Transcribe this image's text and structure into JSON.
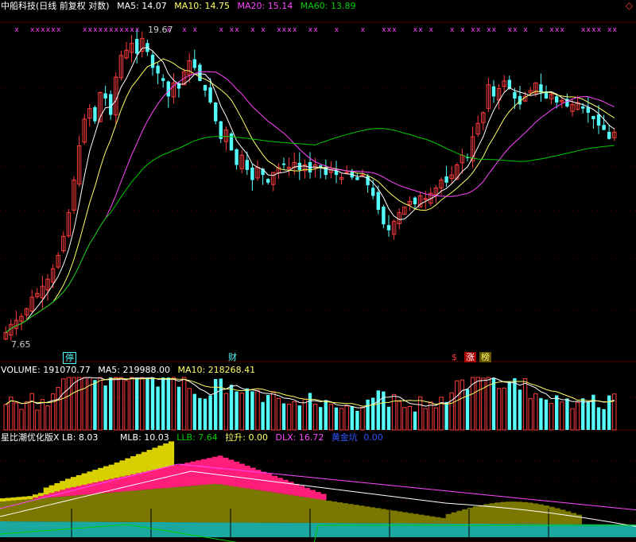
{
  "colors": {
    "bg": "#000000",
    "up": "#ff3c3c",
    "down": "#54fcfc",
    "ma5": "#ffffff",
    "ma10": "#ffff66",
    "ma20": "#ff44ff",
    "ma60": "#00cc00",
    "grid": "#7a0000",
    "x_marks": "#ff44ff"
  },
  "header": {
    "title": "中船科技(日线 前复权 对数)",
    "ma5": "MA5: 14.07",
    "ma10": "MA10: 14.75",
    "ma20": "MA20: 15.14",
    "ma60": "MA60: 13.89"
  },
  "price_panel": {
    "high_label": "19.67",
    "low_label": "7.65",
    "badges": [
      "停",
      "财",
      "$",
      "涨",
      "榜"
    ],
    "corner_icon": "diamond-icon"
  },
  "volume_panel": {
    "label": "VOLUME: 191070.77",
    "ma5": "MA5: 219988.00",
    "ma10": "MA10: 218268.41"
  },
  "indicator_panel": {
    "name": "星比潮优化版X",
    "lb": "LB: 8.03",
    "mlb": "MLB: 10.03",
    "llb": "LLB: 7.64",
    "lashen": "拉升: 0.00",
    "dlx": "DLX: 16.72",
    "huangjinkeng": "黄金坑",
    "hjk_val": "0.00"
  },
  "chart_data": {
    "type": "candlestick",
    "title": "中船科技(日线 前复权 对数)",
    "y_scale": "log",
    "max_label": 19.67,
    "min_label": 7.65,
    "closes": [
      7.7,
      7.9,
      8.0,
      8.1,
      8.3,
      8.6,
      8.7,
      8.9,
      9.1,
      9.4,
      9.8,
      10.4,
      11.2,
      12.4,
      13.8,
      15.0,
      15.5,
      14.9,
      16.3,
      16.0,
      15.2,
      17.1,
      18.3,
      18.6,
      19.0,
      18.4,
      19.3,
      18.5,
      17.6,
      17.3,
      16.9,
      16.1,
      16.8,
      16.5,
      17.4,
      18.0,
      17.6,
      16.9,
      16.4,
      15.8,
      14.9,
      14.1,
      14.5,
      13.6,
      13.0,
      13.4,
      12.8,
      12.4,
      12.9,
      12.6,
      12.3,
      12.7,
      12.9,
      13.0,
      12.9,
      13.1,
      12.8,
      13.0,
      12.7,
      13.0,
      12.9,
      12.6,
      12.8,
      12.6,
      12.5,
      12.7,
      12.5,
      12.4,
      12.6,
      12.2,
      11.8,
      11.3,
      10.8,
      10.6,
      10.9,
      11.2,
      11.4,
      11.6,
      11.5,
      11.8,
      11.7,
      11.9,
      12.1,
      12.4,
      12.3,
      12.6,
      13.0,
      13.4,
      13.3,
      14.2,
      14.8,
      15.3,
      16.7,
      16.1,
      16.5,
      16.9,
      16.5,
      16.0,
      15.7,
      16.1,
      16.4,
      16.8,
      16.3,
      16.0,
      16.2,
      15.8,
      15.9,
      15.6,
      15.7,
      15.8,
      15.5,
      15.3,
      15.0,
      14.7,
      14.5,
      14.1,
      14.4
    ]
  }
}
